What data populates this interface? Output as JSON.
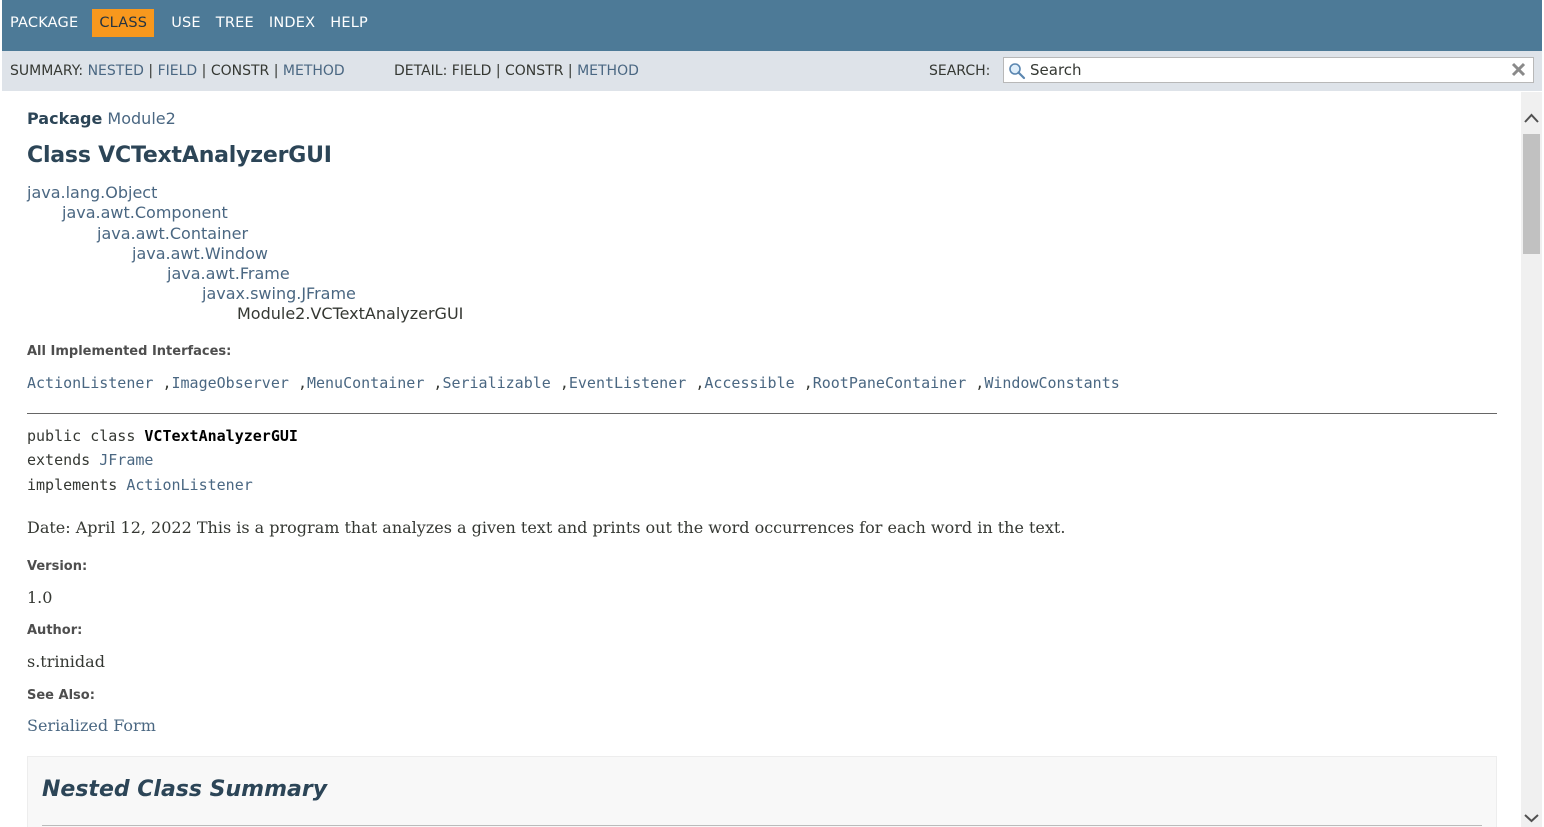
{
  "topnav": {
    "items": [
      "PACKAGE",
      "CLASS",
      "USE",
      "TREE",
      "INDEX",
      "HELP"
    ],
    "active": "CLASS"
  },
  "subnav": {
    "summary_label": "SUMMARY:",
    "summary_nested": "NESTED",
    "summary_field": "FIELD",
    "summary_constr": "CONSTR",
    "summary_method": "METHOD",
    "detail_label": "DETAIL:",
    "detail_field": "FIELD",
    "detail_constr": "CONSTR",
    "detail_method": "METHOD",
    "sep": "|",
    "search_label": "SEARCH:",
    "search_placeholder": "Search"
  },
  "header": {
    "package_label": "Package",
    "package_name": "Module2",
    "title": "Class VCTextAnalyzerGUI"
  },
  "inheritance": [
    "java.lang.Object",
    "java.awt.Component",
    "java.awt.Container",
    "java.awt.Window",
    "java.awt.Frame",
    "javax.swing.JFrame",
    "Module2.VCTextAnalyzerGUI"
  ],
  "interfaces": {
    "label": "All Implemented Interfaces:",
    "items": [
      "ActionListener",
      "ImageObserver",
      "MenuContainer",
      "Serializable",
      "EventListener",
      "Accessible",
      "RootPaneContainer",
      "WindowConstants"
    ],
    "separator": ","
  },
  "signature": {
    "prefix": "public class ",
    "name": "VCTextAnalyzerGUI",
    "extends_kw": "extends ",
    "extends": "JFrame",
    "implements_kw": "implements ",
    "implements": "ActionListener"
  },
  "description": "Date: April 12, 2022 This is a program that analyzes a given text and prints out the word occurrences for each word in the text.",
  "tags": {
    "version_label": "Version:",
    "version": "1.0",
    "author_label": "Author:",
    "author": "s.trinidad",
    "see_also_label": "See Also:",
    "see_also": "Serialized Form"
  },
  "nested_summary": {
    "title": "Nested Class Summary"
  },
  "colors": {
    "topnav_bg": "#4d7a97",
    "active_tab": "#f8981d",
    "subnav_bg": "#dee3e9",
    "link": "#4a6782",
    "heading": "#2c4557"
  }
}
